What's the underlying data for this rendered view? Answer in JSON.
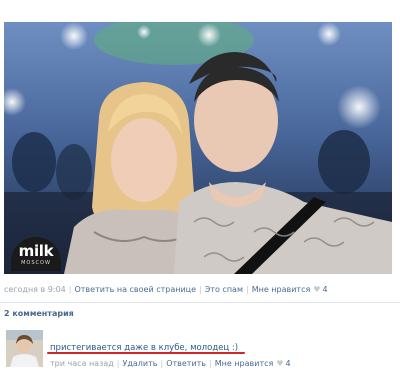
{
  "photo": {
    "watermark_brand": "milk",
    "watermark_city": "MOSCOW"
  },
  "post_meta": {
    "time": "сегодня в 9:04",
    "reply_link": "Ответить на своей странице",
    "spam_link": "Это спам",
    "like_link": "Мне нравится",
    "likes": "4"
  },
  "comments": {
    "count_label": "2 комментария",
    "items": [
      {
        "text": "пристегивается даже в клубе, молодец :)",
        "time": "три часа назад",
        "delete_link": "Удалить",
        "reply_link": "Ответить",
        "like_link": "Мне нравится",
        "likes": "4"
      }
    ]
  },
  "colors": {
    "link": "#4a6c94",
    "muted": "#9aa3ad",
    "annotation": "#d0262a"
  }
}
